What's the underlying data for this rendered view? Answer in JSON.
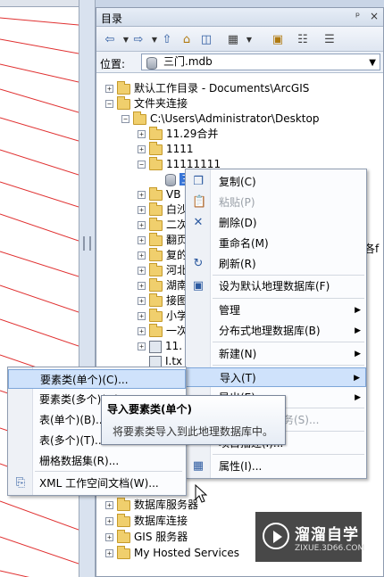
{
  "panel": {
    "title": "目录",
    "pin": "ᵖ",
    "close": "×",
    "location_label": "位置:",
    "location_value": "三门.mdb"
  },
  "tree": [
    {
      "label": "默认工作目录 - Documents\\ArcGIS",
      "exp": "+",
      "icon": "folder",
      "indent": 0
    },
    {
      "label": "文件夹连接",
      "exp": "−",
      "icon": "folder",
      "indent": 0
    },
    {
      "label": "C:\\Users\\Administrator\\Desktop",
      "exp": "−",
      "icon": "folder",
      "indent": 1
    },
    {
      "label": "11.29合并",
      "exp": "+",
      "icon": "folder",
      "indent": 2
    },
    {
      "label": "1111",
      "exp": "+",
      "icon": "folder",
      "indent": 2
    },
    {
      "label": "11111111",
      "exp": "−",
      "icon": "folder",
      "indent": 2
    },
    {
      "label": "三门.mdb",
      "exp": "",
      "icon": "db",
      "indent": 3,
      "selected": true
    },
    {
      "label": "VB",
      "exp": "+",
      "icon": "folder",
      "indent": 2
    },
    {
      "label": "白沙",
      "exp": "+",
      "icon": "folder",
      "indent": 2
    },
    {
      "label": "二次",
      "exp": "+",
      "icon": "folder",
      "indent": 2
    },
    {
      "label": "翻页",
      "exp": "+",
      "icon": "folder",
      "indent": 2
    },
    {
      "label": "复的",
      "exp": "+",
      "icon": "folder",
      "indent": 2
    },
    {
      "label": "河北",
      "exp": "+",
      "icon": "folder",
      "indent": 2
    },
    {
      "label": "湖南",
      "exp": "+",
      "icon": "folder",
      "indent": 2
    },
    {
      "label": "接图",
      "exp": "+",
      "icon": "folder",
      "indent": 2
    },
    {
      "label": "小学",
      "exp": "+",
      "icon": "folder",
      "indent": 2
    },
    {
      "label": "一次",
      "exp": "+",
      "icon": "folder",
      "indent": 2
    },
    {
      "label": "11.",
      "exp": "+",
      "icon": "gdb",
      "indent": 2
    },
    {
      "label": "I.tx",
      "exp": "",
      "icon": "file",
      "indent": 2
    }
  ],
  "tree_bottom": [
    {
      "label": "数据库服务器",
      "exp": "+",
      "icon": "folder"
    },
    {
      "label": "数据库连接",
      "exp": "+",
      "icon": "folder"
    },
    {
      "label": "GIS 服务器",
      "exp": "+",
      "icon": "folder"
    },
    {
      "label": "My Hosted Services",
      "exp": "+",
      "icon": "folder"
    }
  ],
  "partial_right_text": "各f",
  "context_menu": [
    {
      "label": "复制(C)",
      "icon": "❐",
      "disabled": false
    },
    {
      "label": "粘贴(P)",
      "icon": "📋",
      "disabled": true
    },
    {
      "label": "删除(D)",
      "icon": "✕",
      "disabled": false
    },
    {
      "label": "重命名(M)",
      "icon": "",
      "disabled": false
    },
    {
      "label": "刷新(R)",
      "icon": "↻",
      "disabled": false
    },
    {
      "label": "设为默认地理数据库(F)",
      "icon": "▣",
      "disabled": false
    },
    {
      "label": "管理",
      "icon": "",
      "disabled": false,
      "sub": true
    },
    {
      "label": "分布式地理数据库(B)",
      "icon": "",
      "disabled": false,
      "sub": true
    },
    {
      "label": "新建(N)",
      "icon": "",
      "disabled": false,
      "sub": true
    },
    {
      "label": "导入(T)",
      "icon": "",
      "disabled": false,
      "sub": true,
      "highlight": true
    },
    {
      "label": "导出(E)",
      "icon": "",
      "disabled": false,
      "sub": true
    },
    {
      "label": "共享为地图服务(S)...",
      "icon": "",
      "disabled": true
    },
    {
      "label": "项目描述(I)...",
      "icon": "",
      "disabled": false
    },
    {
      "label": "属性(I)...",
      "icon": "▦",
      "disabled": false
    }
  ],
  "submenu": [
    {
      "label": "要素类(单个)(C)...",
      "icon": "",
      "highlight": true
    },
    {
      "label": "要素类(多个)(M)...",
      "icon": ""
    },
    {
      "label": "表(单个)(B)...",
      "icon": ""
    },
    {
      "label": "表(多个)(T)...",
      "icon": ""
    },
    {
      "label": "栅格数据集(R)...",
      "icon": ""
    },
    {
      "label": "XML 工作空间文档(W)...",
      "icon": "⎘"
    }
  ],
  "tooltip": {
    "title": "导入要素类(单个)",
    "desc": "将要素类导入到此地理数据库中。"
  },
  "watermark": {
    "line1": "溜溜自学",
    "line2": "ZIXUE.3D66.COM"
  }
}
